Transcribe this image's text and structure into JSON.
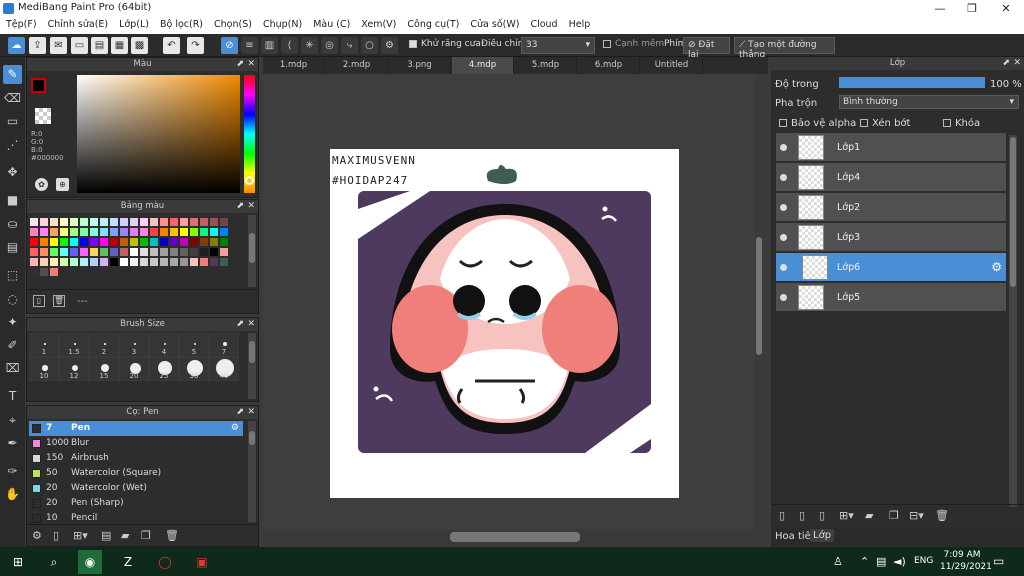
{
  "window": {
    "title": "MediBang Paint Pro (64bit)",
    "minimize": "—",
    "maximize": "❐",
    "close": "✕"
  },
  "menu": [
    "Tệp(F)",
    "Chỉnh sửa(E)",
    "Lớp(L)",
    "Bộ lọc(R)",
    "Chọn(S)",
    "Chụp(N)",
    "Màu (C)",
    "Xem(V)",
    "Công cụ(T)",
    "Cửa số(W)",
    "Cloud",
    "Help"
  ],
  "toolbar": {
    "antialias_label": "Khử răng cưa",
    "correction_label": "Điều chỉnh",
    "correction_value": "33",
    "edge_label": "Cạnh mềm",
    "key_label": "Phím",
    "reset_label": "Đặt lại",
    "straight_label": "Tạo một đường thẳng"
  },
  "color_panel": {
    "title": "Màu",
    "r": "R:0",
    "g": "G:0",
    "b": "B:0",
    "hex": "#000000"
  },
  "palette_panel": {
    "title": "Bảng màu",
    "footer": "---"
  },
  "brushsize_panel": {
    "title": "Brush Size",
    "sizes": [
      "1",
      "1.5",
      "2",
      "3",
      "4",
      "5",
      "7",
      "10",
      "12",
      "15",
      "20",
      "25",
      "30",
      "40"
    ]
  },
  "pen_panel": {
    "title": "Cọ: Pen",
    "items": [
      {
        "size": "7",
        "name": "Pen",
        "color": "#2d2d2d",
        "selected": true
      },
      {
        "size": "1000",
        "name": "Blur",
        "color": "#f08ad8"
      },
      {
        "size": "150",
        "name": "Airbrush",
        "color": "#d9d9d9"
      },
      {
        "size": "50",
        "name": "Watercolor (Square)",
        "color": "#b8e06a"
      },
      {
        "size": "20",
        "name": "Watercolor (Wet)",
        "color": "#7fd3f0"
      },
      {
        "size": "20",
        "name": "Pen (Sharp)",
        "color": "#2d2d2d"
      },
      {
        "size": "10",
        "name": "Pencil",
        "color": "#2d2d2d"
      }
    ]
  },
  "tabs": [
    "1.mdp",
    "2.mdp",
    "3.png",
    "4.mdp",
    "5.mdp",
    "6.mdp",
    "Untitled"
  ],
  "active_tab": "4.mdp",
  "canvas": {
    "watermark1": "MAXIMUSVENN",
    "watermark2": "#HOIDAP247"
  },
  "layer_panel": {
    "title": "Lớp",
    "opacity_label": "Độ trong",
    "opacity_value": "100 %",
    "blend_label": "Pha trộn",
    "blend_value": "Bình thường",
    "protect_alpha": "Bảo vệ alpha",
    "clipping": "Xén bớt",
    "lock": "Khóa",
    "layers": [
      "Lớp1",
      "Lớp4",
      "Lớp2",
      "Lớp3",
      "Lớp6",
      "Lớp5"
    ],
    "selected": "Lớp6"
  },
  "bottom_tabs": [
    "Hoa tiêu",
    "Lớp"
  ],
  "taskbar": {
    "lang": "ENG",
    "time": "7:09 AM",
    "date": "11/29/2021"
  },
  "colors": {
    "accent": "#4a8fd6",
    "bg_purple": "#4d3a5e",
    "blush": "#f07f7a",
    "mushroom_pink": "#f6c3c0"
  }
}
